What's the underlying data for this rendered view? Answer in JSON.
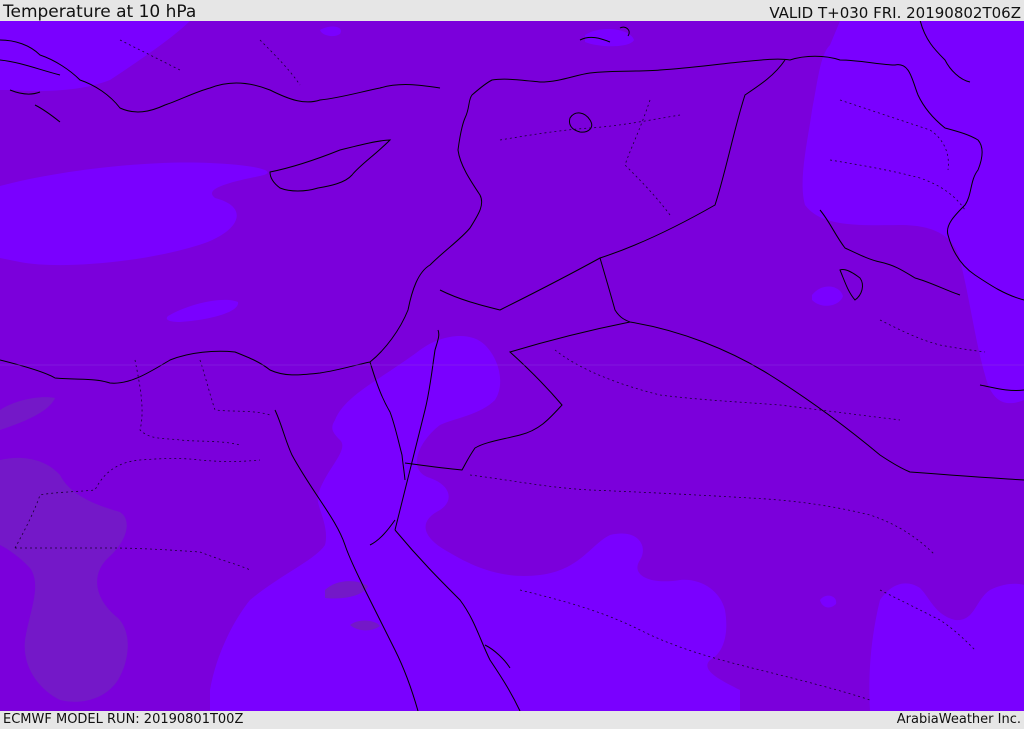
{
  "header": {
    "title": "Temperature at 10 hPa",
    "valid_time": "VALID T+030 FRI. 20190802T06Z"
  },
  "footer": {
    "model_run": "ECMWF MODEL RUN: 20190801T00Z",
    "credit": "ArabiaWeather Inc."
  },
  "colors": {
    "base_fill": "#7b00db",
    "warm_band": "#7a00ff",
    "cool_patch": "#7418c8",
    "coastline": "#000000",
    "border": "#1a0033"
  },
  "map_layers": [
    "temperature-shading",
    "coastlines",
    "country-borders",
    "admin-borders"
  ]
}
